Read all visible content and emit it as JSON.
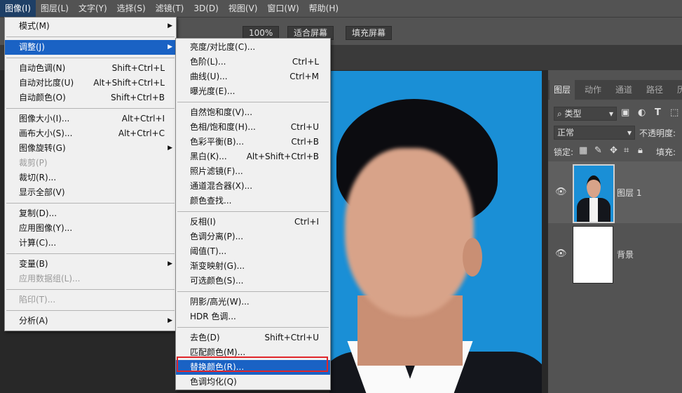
{
  "menubar": {
    "items": [
      "图像(I)",
      "图层(L)",
      "文字(Y)",
      "选择(S)",
      "滤镜(T)",
      "3D(D)",
      "视图(V)",
      "窗口(W)",
      "帮助(H)"
    ]
  },
  "options_bar": {
    "dim_label": "",
    "zoom": "100%",
    "fit_screen": "适合屏幕",
    "fill_screen": "填充屏幕"
  },
  "image_menu": [
    {
      "label": "模式(M)",
      "shortcut": "",
      "submenu": true
    },
    {
      "label": "调整(J)",
      "shortcut": "",
      "submenu": true,
      "highlighted": true
    },
    {
      "label": "自动色调(N)",
      "shortcut": "Shift+Ctrl+L"
    },
    {
      "label": "自动对比度(U)",
      "shortcut": "Alt+Shift+Ctrl+L"
    },
    {
      "label": "自动颜色(O)",
      "shortcut": "Shift+Ctrl+B"
    },
    {
      "label": "图像大小(I)...",
      "shortcut": "Alt+Ctrl+I"
    },
    {
      "label": "画布大小(S)...",
      "shortcut": "Alt+Ctrl+C"
    },
    {
      "label": "图像旋转(G)",
      "shortcut": "",
      "submenu": true
    },
    {
      "label": "裁剪(P)",
      "shortcut": "",
      "disabled": true
    },
    {
      "label": "裁切(R)...",
      "shortcut": ""
    },
    {
      "label": "显示全部(V)",
      "shortcut": ""
    },
    {
      "label": "复制(D)...",
      "shortcut": ""
    },
    {
      "label": "应用图像(Y)...",
      "shortcut": ""
    },
    {
      "label": "计算(C)...",
      "shortcut": ""
    },
    {
      "label": "变量(B)",
      "shortcut": "",
      "submenu": true
    },
    {
      "label": "应用数据组(L)...",
      "shortcut": "",
      "disabled": true
    },
    {
      "label": "陷印(T)...",
      "shortcut": "",
      "disabled": true
    },
    {
      "label": "分析(A)",
      "shortcut": "",
      "submenu": true
    }
  ],
  "adjust_menu": [
    {
      "label": "亮度/对比度(C)...",
      "shortcut": ""
    },
    {
      "label": "色阶(L)...",
      "shortcut": "Ctrl+L"
    },
    {
      "label": "曲线(U)...",
      "shortcut": "Ctrl+M"
    },
    {
      "label": "曝光度(E)...",
      "shortcut": ""
    },
    {
      "label": "自然饱和度(V)...",
      "shortcut": ""
    },
    {
      "label": "色相/饱和度(H)...",
      "shortcut": "Ctrl+U"
    },
    {
      "label": "色彩平衡(B)...",
      "shortcut": "Ctrl+B"
    },
    {
      "label": "黑白(K)...",
      "shortcut": "Alt+Shift+Ctrl+B"
    },
    {
      "label": "照片滤镜(F)...",
      "shortcut": ""
    },
    {
      "label": "通道混合器(X)...",
      "shortcut": ""
    },
    {
      "label": "颜色查找...",
      "shortcut": ""
    },
    {
      "label": "反相(I)",
      "shortcut": "Ctrl+I"
    },
    {
      "label": "色调分离(P)...",
      "shortcut": ""
    },
    {
      "label": "阈值(T)...",
      "shortcut": ""
    },
    {
      "label": "渐变映射(G)...",
      "shortcut": ""
    },
    {
      "label": "可选颜色(S)...",
      "shortcut": ""
    },
    {
      "label": "阴影/高光(W)...",
      "shortcut": ""
    },
    {
      "label": "HDR 色调...",
      "shortcut": ""
    },
    {
      "label": "去色(D)",
      "shortcut": "Shift+Ctrl+U"
    },
    {
      "label": "匹配颜色(M)...",
      "shortcut": ""
    },
    {
      "label": "替换颜色(R)...",
      "shortcut": "",
      "highlighted": true
    },
    {
      "label": "色调均化(Q)",
      "shortcut": ""
    }
  ],
  "layers_panel": {
    "tabs": [
      "图层",
      "动作",
      "通道",
      "路径",
      "历"
    ],
    "filter_label": "类型",
    "blend_mode": "正常",
    "opacity_label": "不透明度:",
    "lock_label": "锁定:",
    "fill_label": "填充:",
    "layers": [
      {
        "name": "图层 1",
        "selected": true
      },
      {
        "name": "背景",
        "selected": false
      }
    ]
  },
  "colors": {
    "menu_highlight": "#1a62c4",
    "photo_bg": "#1a8fd6",
    "callout": "#e0262a"
  }
}
